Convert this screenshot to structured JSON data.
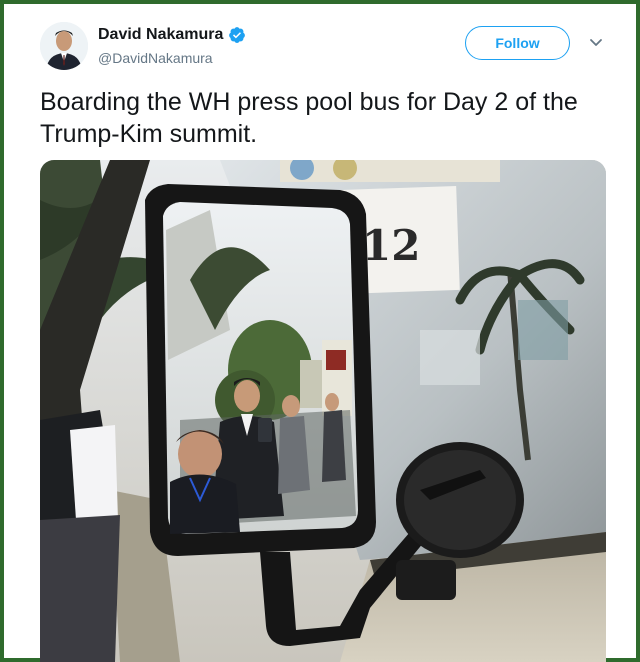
{
  "tweet": {
    "author": {
      "display_name": "David Nakamura",
      "handle": "@DavidNakamura",
      "verified": true,
      "avatar_icon": "profile-photo"
    },
    "follow_label": "Follow",
    "menu_icon": "chevron-down-icon",
    "text": "Boarding the WH press pool bus for Day 2 of the Trump-Kim summit.",
    "media": {
      "description_icon": "photo",
      "bus_number": "12"
    }
  },
  "colors": {
    "accent": "#1da1f2",
    "frame": "#2f6b2d",
    "text": "#14171a",
    "secondary": "#657786"
  }
}
